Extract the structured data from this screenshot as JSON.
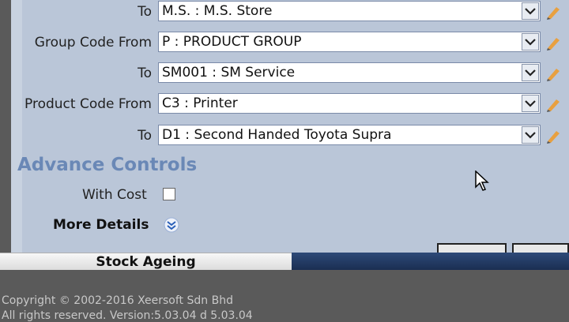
{
  "form": {
    "rows": [
      {
        "label": "To",
        "value": "M.S. : M.S. Store"
      },
      {
        "label": "Group Code From",
        "value": "P : PRODUCT GROUP"
      },
      {
        "label": "To",
        "value": "SM001 : SM Service"
      },
      {
        "label": "Product Code From",
        "value": "C3 : Printer"
      },
      {
        "label": "To",
        "value": "D1 : Second Handed Toyota Supra"
      }
    ],
    "advance_heading": "Advance Controls",
    "with_cost_label": "With Cost",
    "with_cost_checked": false,
    "more_details_label": "More Details"
  },
  "tabs": {
    "active_label": "Stock Ageing"
  },
  "footer": {
    "copyright": "Copyright © 2002-2016 Xeersoft Sdn Bhd",
    "rights": "All rights reserved. Version:5.03.04 d 5.03.04"
  },
  "colors": {
    "panel_bg": "#bac6d8",
    "heading": "#6a88b6",
    "tab_dark": "#1a2e52",
    "footer_bg": "#5a5a5a"
  }
}
